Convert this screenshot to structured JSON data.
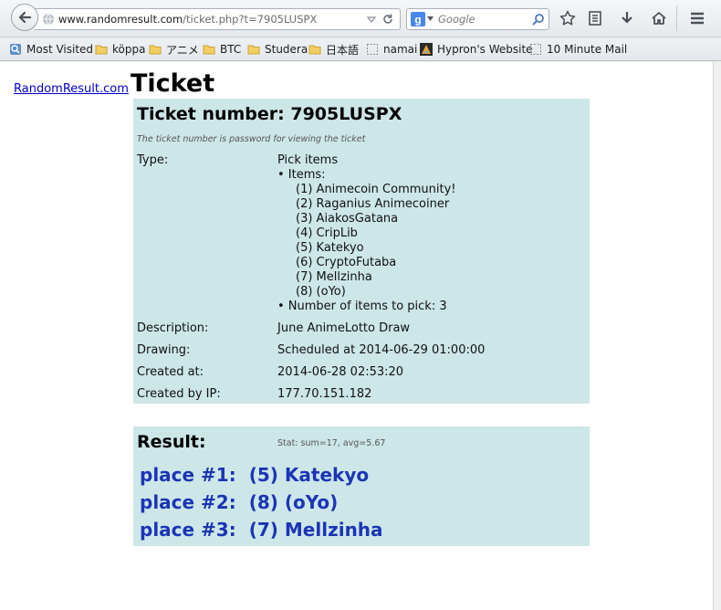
{
  "browser": {
    "url_host": "www.randomresult.com",
    "url_path": "/ticket.php?t=7905LUSPX",
    "search_placeholder": "Google"
  },
  "bookmarks": [
    {
      "label": "Most Visited",
      "icon": "most-visited-icon"
    },
    {
      "label": "köppa",
      "icon": "folder-icon"
    },
    {
      "label": "アニメ",
      "icon": "folder-icon"
    },
    {
      "label": "BTC",
      "icon": "folder-icon"
    },
    {
      "label": "Studera",
      "icon": "folder-icon"
    },
    {
      "label": "日本語",
      "icon": "folder-icon"
    },
    {
      "label": "namai",
      "icon": "blank-page-icon"
    },
    {
      "label": "Hypron's Website",
      "icon": "site-favicon-icon"
    },
    {
      "label": "10 Minute Mail",
      "icon": "blank-page-icon"
    }
  ],
  "page": {
    "site_link": "RandomResult.com",
    "title": "Ticket"
  },
  "ticket": {
    "heading": "Ticket number: 7905LUSPX",
    "note": "The ticket number is password for viewing the ticket",
    "type_label": "Type:",
    "type_value": "Pick items",
    "items_label": "• Items:",
    "items": [
      "(1) Animecoin Community!",
      "(2) Raganius Animecoiner",
      "(3) AiakosGatana",
      "(4) CripLib",
      "(5) Katekyo",
      "(6) CryptoFutaba",
      "(7) Mellzinha",
      "(8) (oYo)"
    ],
    "pick_count": "• Number of items to pick: 3",
    "description_label": "Description:",
    "description_value": "June AnimeLotto Draw",
    "drawing_label": "Drawing:",
    "drawing_value": "Scheduled at 2014-06-29 01:00:00",
    "created_label": "Created at:",
    "created_value": "2014-06-28 02:53:20",
    "ip_label": "Created by IP:",
    "ip_value": "177.70.151.182"
  },
  "result": {
    "heading": "Result:",
    "stat": "Stat: sum=17, avg=5.67",
    "places": [
      {
        "place": "place #1:",
        "item": "(5) Katekyo"
      },
      {
        "place": "place #2:",
        "item": "(8) (oYo)"
      },
      {
        "place": "place #3:",
        "item": "(7) Mellzinha"
      }
    ]
  },
  "colors": {
    "panel_bg": "#cde6e8",
    "result_link": "#1a35b5",
    "site_link": "#0000cc"
  }
}
